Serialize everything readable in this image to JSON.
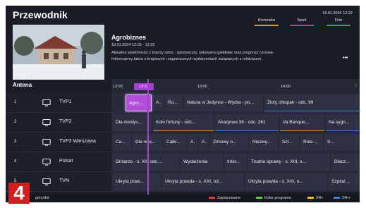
{
  "app": {
    "title": "Przewodnik",
    "date": "18.01.2024 12:22"
  },
  "preview": {
    "label": "TVP1"
  },
  "filters": [
    {
      "label": "Rozrywka",
      "color": "#e8912f"
    },
    {
      "label": "Sport",
      "color": "#c8388a"
    },
    {
      "label": "Film",
      "color": "#3f7fe0"
    }
  ],
  "program": {
    "title": "Agrobiznes",
    "time": "18.01.2024 12:05 - 12:25",
    "description_line1": "Aktualne wiadomości z branży rolno - spożywczej, notowania giełdowe oraz prognozy cenowe.",
    "description_line2": "Informujemy także o krajowych i zagranicznych wydarzeniach związanych z rolnictwem.",
    "more": "•••"
  },
  "guide": {
    "section_label": "Antena",
    "timeline": {
      "marks": [
        "12:00",
        "13:00",
        "14:00"
      ],
      "now": "12:22",
      "arrow": "›"
    },
    "channels": [
      {
        "number": "1",
        "name": "TVP1",
        "icon": "tv-icon",
        "programs": [
          {
            "title": "Agro...",
            "focused": true
          },
          {
            "title": "A."
          },
          {
            "title": "Ro..."
          },
          {
            "title": "Natura w Jedynce - Wydra - po..."
          },
          {
            "title": "Złoty chłopak - odc. 99",
            "bar": "#3f7fe0"
          }
        ]
      },
      {
        "number": "2",
        "name": "TVP2",
        "icon": "tv-icon",
        "programs": [
          {
            "title": "Dla niesłys..."
          },
          {
            "title": "Koło fortuny - odc...",
            "bar": "#e8912f"
          },
          {
            "title": "Akacjowa 38 - odc. 261",
            "bar": "#3f7fe0"
          },
          {
            "title": "Va Banque...",
            "bar": "#e8912f"
          },
          {
            "title": "Na sygn...",
            "bar": "#3f7fe0"
          }
        ]
      },
      {
        "number": "3",
        "name": "TVP3 Warszawa",
        "icon": "tv-icon",
        "programs": [
          {
            "title": "Ca..."
          },
          {
            "title": "Dla nies..."
          },
          {
            "title": "Całki..."
          },
          {
            "title": "A."
          },
          {
            "title": "A."
          },
          {
            "title": "Zimowy o..."
          },
          {
            "title": "Niezwy..."
          },
          {
            "title": "Szl..."
          },
          {
            "title": "Rola ..."
          },
          {
            "title": "S..."
          }
        ]
      },
      {
        "number": "4",
        "name": "Polsat",
        "icon": "tv-icon",
        "programs": [
          {
            "title": "Giniarze - s. XII, odc...."
          },
          {
            "title": "Wydarzenia"
          },
          {
            "title": "Inter..."
          },
          {
            "title": "Trudne sprawy - s. XIII, o..."
          },
          {
            "title": "Dlacz..."
          }
        ]
      },
      {
        "number": "5",
        "name": "TVN",
        "icon": "tv-icon",
        "programs": [
          {
            "title": "Ukryta praw..."
          },
          {
            "title": "Ukryta prawda - s. XXI, od..."
          },
          {
            "title": "Ukryta prawda - s. XXI, o..."
          },
          {
            "title": "Szpital ..."
          }
        ]
      }
    ]
  },
  "footer": {
    "hint": "góry/dół",
    "legend": [
      {
        "label": "Zaplanowane",
        "color": "#e53935"
      },
      {
        "label": "Kolor programu",
        "color": "#66cc33"
      },
      {
        "label": "24h-",
        "color": "#f2c200"
      },
      {
        "label": "24h+",
        "color": "#3f7fe0"
      }
    ]
  },
  "badge": {
    "text": "4",
    "color": "#d31f1f"
  }
}
